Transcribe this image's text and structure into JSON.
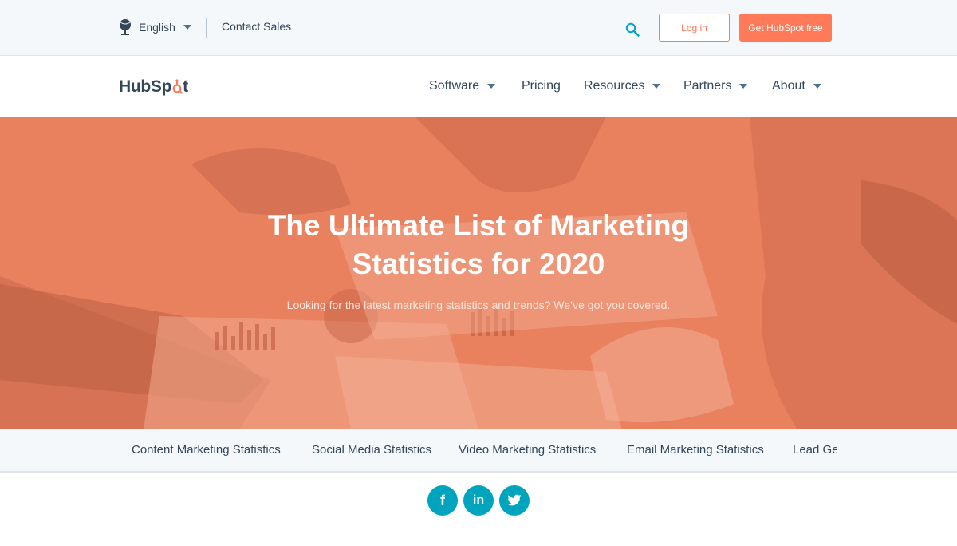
{
  "utility_bar": {
    "language": "English",
    "contact": "Contact Sales",
    "login": "Log in",
    "get_free": "Get HubSpot free"
  },
  "logo": {
    "text_left": "HubSp",
    "text_right": "t"
  },
  "nav": [
    {
      "label": "Software"
    },
    {
      "label": "Pricing"
    },
    {
      "label": "Resources"
    },
    {
      "label": "Partners"
    },
    {
      "label": "About"
    }
  ],
  "hero": {
    "title_line1": "The Ultimate List of Marketing",
    "title_line2": "Statistics for 2020",
    "subtitle": "Looking for the latest marketing statistics and trends? We’ve got you covered."
  },
  "subnav": [
    {
      "label": "Content Marketing Statistics"
    },
    {
      "label": "Social Media Statistics"
    },
    {
      "label": "Video Marketing Statistics"
    },
    {
      "label": "Email Marketing Statistics"
    },
    {
      "label": "Lead Generation Statistics"
    }
  ],
  "social": {
    "facebook": "f",
    "linkedin": "in"
  },
  "colors": {
    "accent": "#ff7a59",
    "text": "#33475b",
    "hero_overlay": "#e9815f",
    "social": "#00a4bd",
    "surface": "#f5f8fa"
  },
  "icons": [
    "globe-icon",
    "chevron-down-icon",
    "search-icon",
    "sprocket-icon",
    "facebook-icon",
    "linkedin-icon",
    "twitter-icon"
  ]
}
